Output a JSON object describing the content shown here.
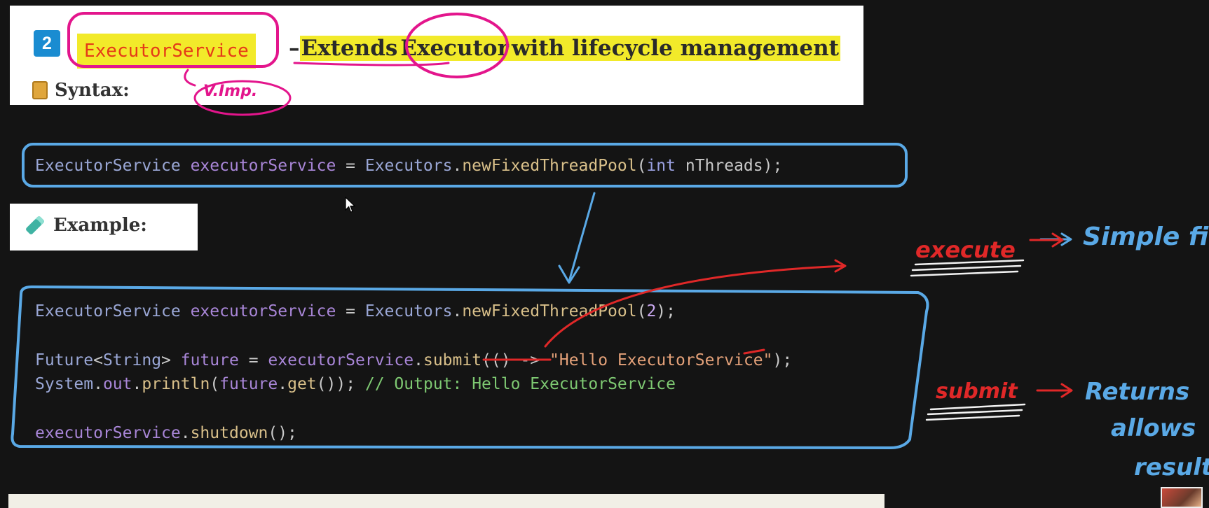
{
  "header": {
    "section_number": "2",
    "class_name": "ExecutorService",
    "dash": "– ",
    "title_pre": "Extends ",
    "title_executor": "Executor",
    "title_post": " with lifecycle management",
    "syntax_label": "Syntax:"
  },
  "syntax_code": {
    "type": "ExecutorService",
    "var": "executorService",
    "eq": " = ",
    "cls": "Executors",
    "dot": ".",
    "method": "newFixedThreadPool",
    "open": "(",
    "param_type": "int",
    "param_name": "nThreads",
    "close": ");"
  },
  "example": {
    "label": "Example:",
    "line1": {
      "type": "ExecutorService",
      "var": "executorService",
      "eq": " = ",
      "cls": "Executors",
      "dot": ".",
      "method": "newFixedThreadPool",
      "open": "(",
      "arg": "2",
      "close": ");"
    },
    "line2": {
      "type": "Future",
      "generic_open": "<",
      "generic_type": "String",
      "generic_close": ">",
      "var": "future",
      "eq": " = ",
      "obj": "executorService",
      "dot": ".",
      "method": "submit",
      "lambda": "(() -> ",
      "string": "\"Hello ExecutorService\"",
      "close": ");"
    },
    "line3": {
      "cls": "System",
      "dot1": ".",
      "field": "out",
      "dot2": ".",
      "method": "println",
      "open": "(",
      "obj": "future",
      "dot3": ".",
      "call": "get",
      "close": "());",
      "comment": " // Output: Hello ExecutorService"
    },
    "line4": {
      "obj": "executorService",
      "dot": ".",
      "method": "shutdown",
      "close": "();"
    }
  },
  "annotations": {
    "vimp": "V.Imp.",
    "execute": "execute",
    "simple": "Simple fi",
    "submit": "submit",
    "returns": "Returns",
    "allows": "allows",
    "result": "result"
  },
  "colors": {
    "background": "#141414",
    "highlight": "#f2ea2a",
    "pink_marker": "#e3158c",
    "blue_marker": "#5aa9e6",
    "red_marker": "#e02828"
  }
}
